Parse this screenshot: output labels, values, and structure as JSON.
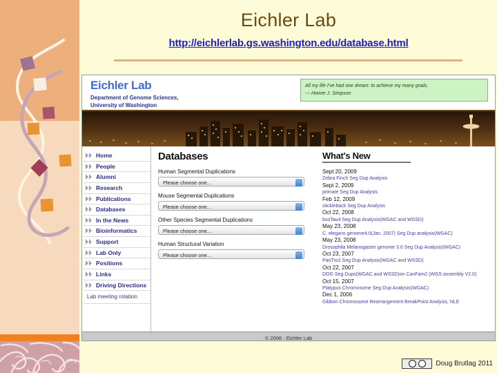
{
  "slide": {
    "title": "Eichler Lab",
    "url": "http://eichlerlab.gs.washington.edu/database.html",
    "credit": "Doug Brutlag 2011",
    "credit_badge_icon": "creative-commons-badge-icon"
  },
  "site": {
    "logo": "Eichler Lab",
    "department_line1": "Department of Genome Sciences,",
    "department_line2": "University of Washington",
    "quote_text": "All my life I've had one dream: to achieve my many goals.",
    "quote_attribution": "--- Homer J. Simpson",
    "banner_alt": "seattle-skyline-night-photo",
    "footer": "© 2006 - Eichler Lab",
    "nav": {
      "bullet_icon": "double-chevron-icon",
      "items": [
        "Home",
        "People",
        "Alumni",
        "Research",
        "Publications",
        "Databases",
        "In the News",
        "Bioinformatics",
        "Support",
        "Lab Only",
        "Positions",
        "Links",
        "Driving Directions"
      ],
      "plain_item": "Lab meeting rotation"
    },
    "databases": {
      "heading": "Databases",
      "placeholder": "Please choose one...",
      "groups": [
        {
          "label": "Human Segmental Duplications",
          "value": "Please choose one..."
        },
        {
          "label": "Mouse Segmental Duplications",
          "value": "Please choose one..."
        },
        {
          "label": "Other Species Segmental Duplications",
          "value": "Please choose one..."
        },
        {
          "label": "Human Structural Variation",
          "value": "Please choose one..."
        }
      ]
    },
    "whats_new": {
      "heading": "What's New",
      "entries": [
        {
          "date": "Sept 20, 2009",
          "desc": "Zebra Finch Seg Dup Analysis"
        },
        {
          "date": "Sept 2, 2009",
          "desc": "primate Seg Dup Analysis"
        },
        {
          "date": "Feb 12, 2009",
          "desc": "stickleback Seg Dup Analysis"
        },
        {
          "date": "Oct 22, 2008",
          "desc": "bosTau4 Seg Dup Analysis(WGAC and WSSD)"
        },
        {
          "date": "May 23, 2008",
          "desc": "C. elegans genome4.0(Jan. 2007) Seg Dup analysis(WGAC)"
        },
        {
          "date": "May 23, 2008",
          "desc": "Drosophila Melanogaster genome 3.0 Seg Dup Analysis(WGAC)"
        },
        {
          "date": "Oct 23, 2007",
          "desc": "PanTro2 Seg Dup Analysis(WGAC and WSSD)"
        },
        {
          "date": "Oct 22, 2007",
          "desc": "DOG Seg Dups(WGAC and WSSD)on CanFam2 (WGS assembly V2.0)"
        },
        {
          "date": "Oct 15, 2007",
          "desc": "Platypus Chromosome Seg Dup Analysis(WGAC)"
        },
        {
          "date": "Dec 1, 2006",
          "desc": "Gibbon Chromosome Rearrangement BreakPoint Analysis, NLE"
        }
      ]
    }
  },
  "colors": {
    "slide_bg": "#fdfbd8",
    "title": "#6b4a12",
    "url_link": "#1c1ccc",
    "sidebar_top": "#edb07c",
    "sidebar_mid": "#f7d9bd",
    "orange_bar": "#f08122",
    "paisley": "#cfa0a6",
    "site_logo": "#4169d8",
    "nav_link": "#2b2b8f",
    "quote_bg": "#cdf2c4"
  }
}
